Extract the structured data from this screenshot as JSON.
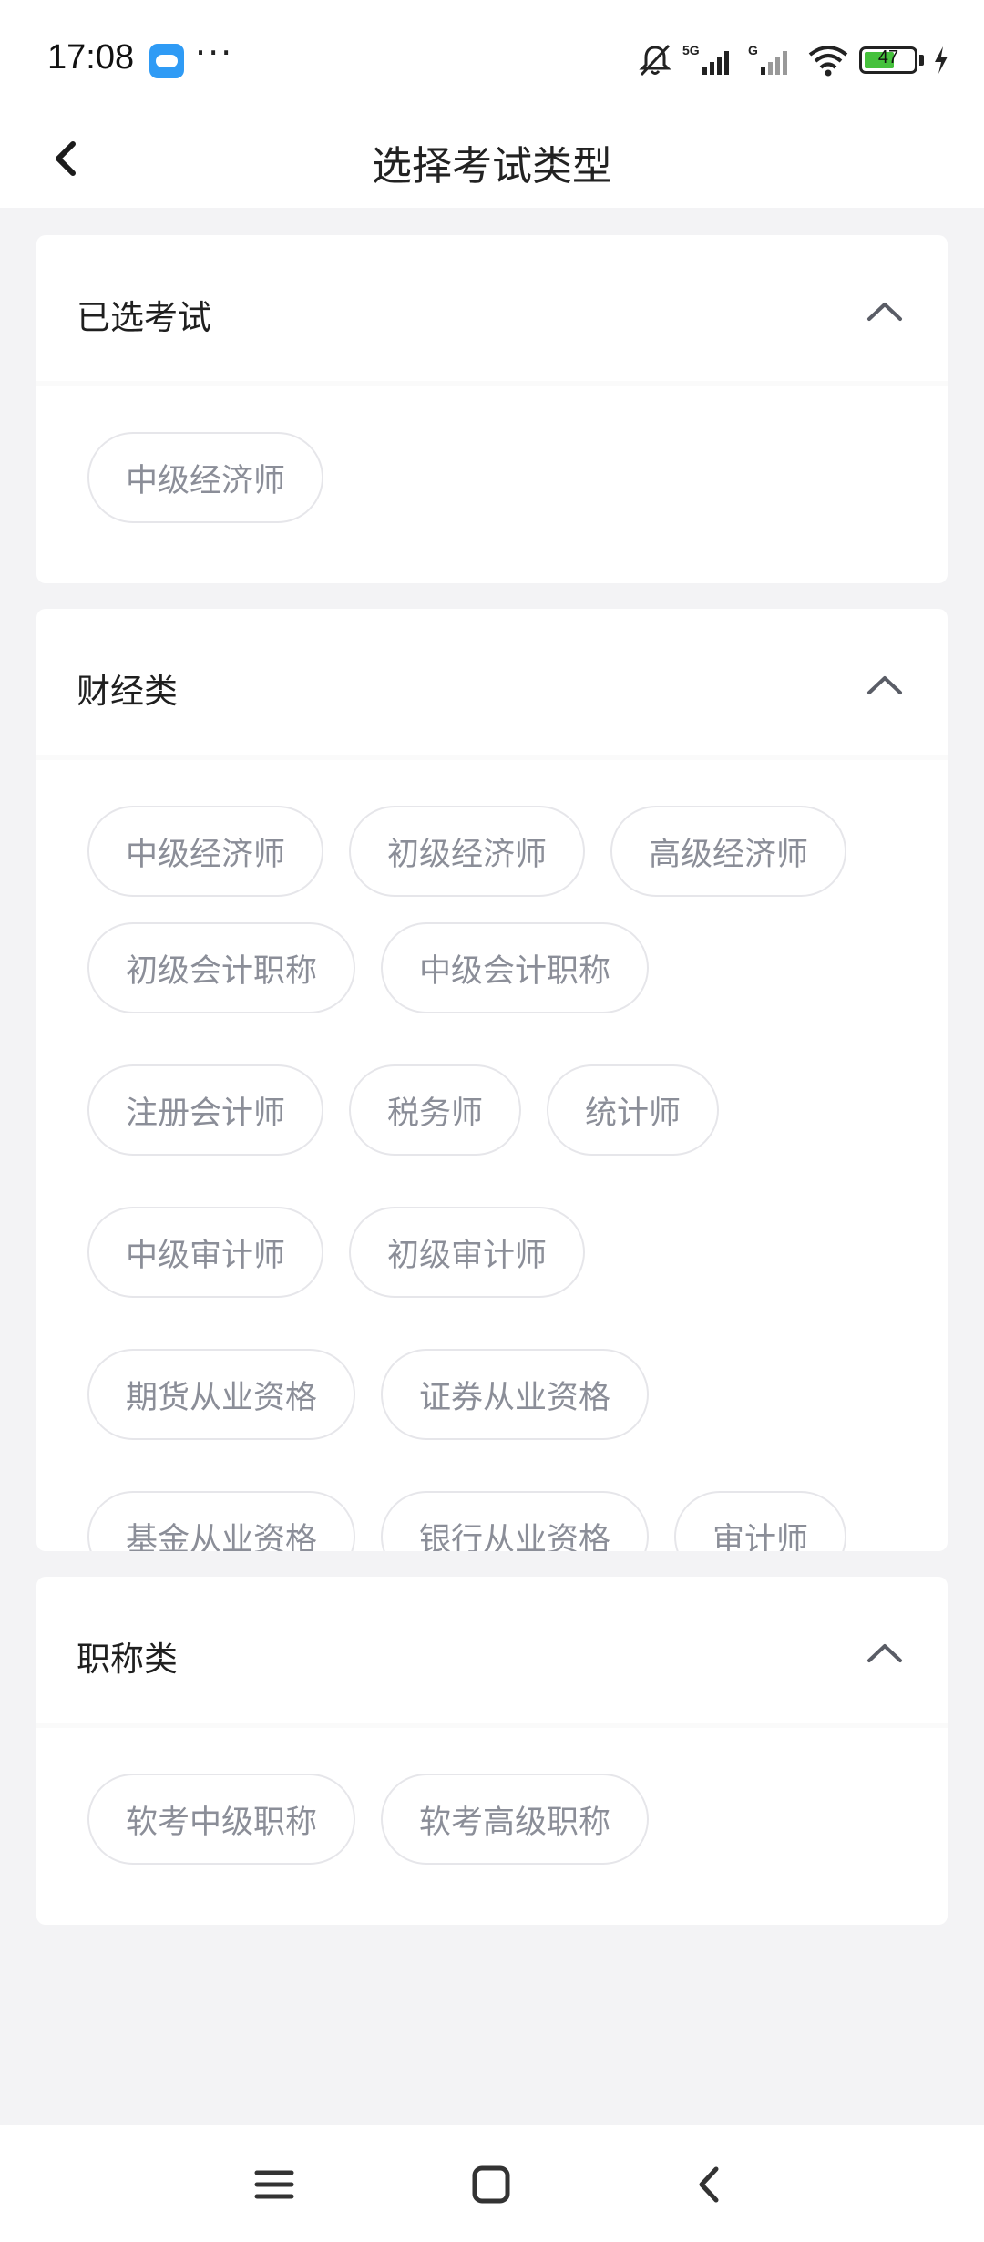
{
  "status_bar": {
    "time": "17:08",
    "more": "···",
    "network_label": "5G",
    "network_label_2": "G",
    "battery": "47",
    "app_icon": "weather-cloud-icon"
  },
  "header": {
    "title": "选择考试类型",
    "back_icon": "chevron-left-icon"
  },
  "sections": [
    {
      "title": "已选考试",
      "items": [
        "中级经济师"
      ]
    },
    {
      "title": "财经类",
      "items": [
        "中级经济师",
        "初级经济师",
        "高级经济师",
        "初级会计职称",
        "中级会计职称",
        "注册会计师",
        "税务师",
        "统计师",
        "中级审计师",
        "初级审计师",
        "期货从业资格",
        "证券从业资格",
        "基金从业资格",
        "银行从业资格",
        "审计师"
      ]
    },
    {
      "title": "职称类",
      "items": [
        "软考中级职称",
        "软考高级职称"
      ]
    }
  ],
  "colors": {
    "page_bg": "#f3f3f5",
    "chip_text": "#8b8e98",
    "chip_border": "#e6e6ea",
    "battery_green": "#45c13c"
  }
}
